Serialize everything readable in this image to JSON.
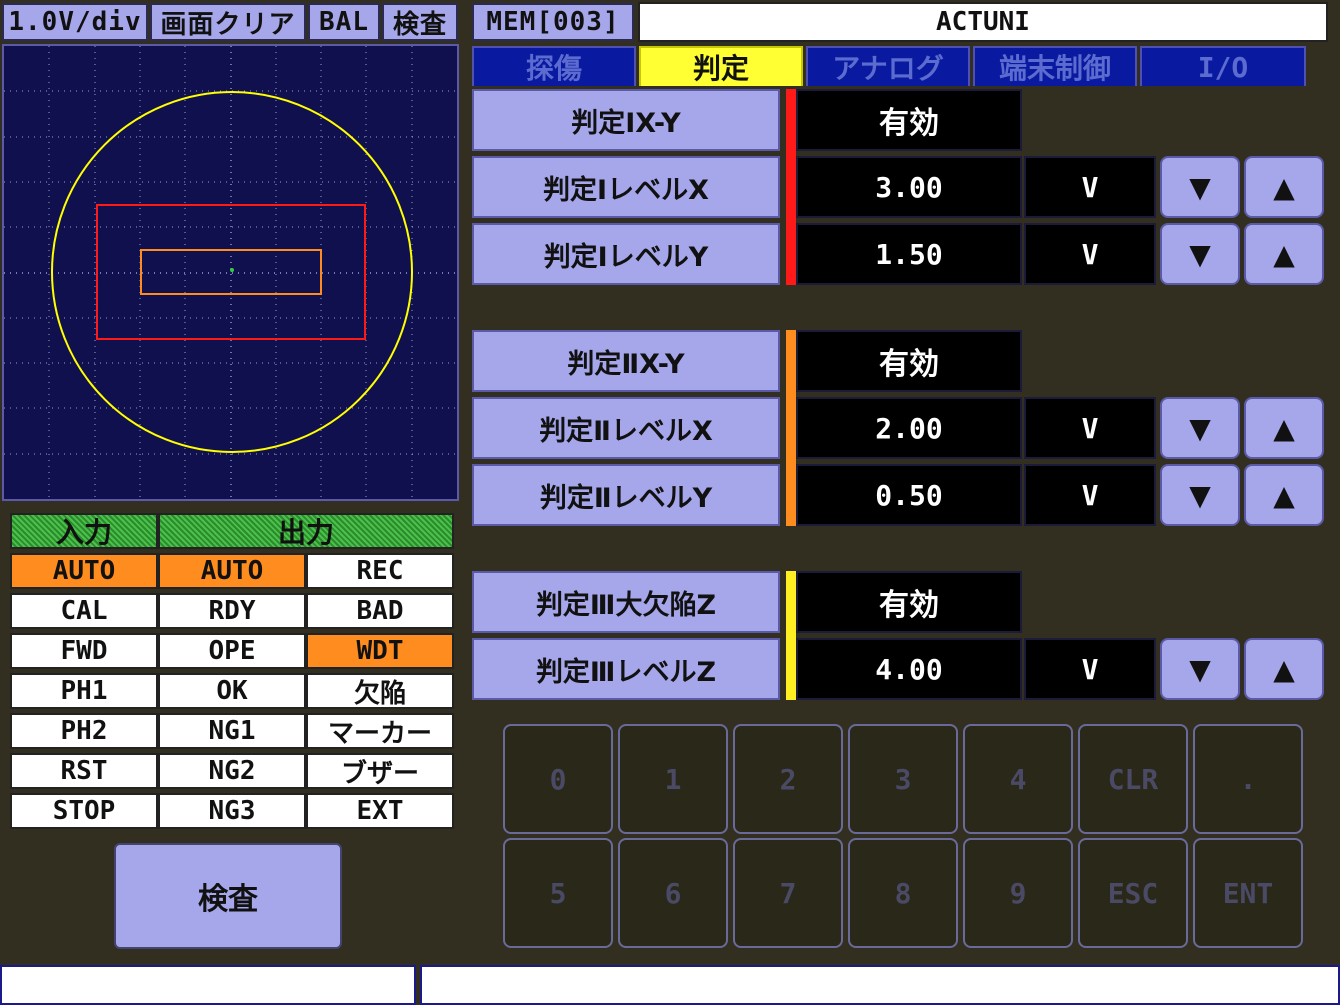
{
  "toolbar": {
    "scale": "1.0V/div",
    "clear": "画面クリア",
    "bal": "BAL",
    "inspect": "検査",
    "mem": "MEM[003]",
    "title": "ACTUNI"
  },
  "tabs": [
    "探傷",
    "判定",
    "アナログ",
    "端末制御",
    "I/O"
  ],
  "active_tab": "判定",
  "judge": {
    "j1": {
      "xy_label": "判定ⅠX-Y",
      "xy_value": "有効",
      "lx_label": "判定ⅠレベルX",
      "lx_value": "3.00",
      "lx_unit": "V",
      "ly_label": "判定ⅠレベルY",
      "ly_value": "1.50",
      "ly_unit": "V",
      "color": "#ff1a1a"
    },
    "j2": {
      "xy_label": "判定ⅡX-Y",
      "xy_value": "有効",
      "lx_label": "判定ⅡレベルX",
      "lx_value": "2.00",
      "lx_unit": "V",
      "ly_label": "判定ⅡレベルY",
      "ly_value": "0.50",
      "ly_unit": "V",
      "color": "#ff8c1e"
    },
    "j3": {
      "z_label": "判定Ⅲ大欠陥Z",
      "z_value": "有効",
      "lz_label": "判定ⅢレベルZ",
      "lz_value": "4.00",
      "lz_unit": "V",
      "color": "#ffee22"
    }
  },
  "arrows": {
    "down": "▼",
    "up": "▲"
  },
  "io": {
    "input_header": "入力",
    "output_header": "出力",
    "inputs": [
      "AUTO",
      "CAL",
      "FWD",
      "PH1",
      "PH2",
      "RST",
      "STOP"
    ],
    "outputs1": [
      "AUTO",
      "RDY",
      "OPE",
      "OK",
      "NG1",
      "NG2",
      "NG3"
    ],
    "outputs2": [
      "REC",
      "BAD",
      "WDT",
      "欠陥",
      "マーカー",
      "ブザー",
      "EXT"
    ]
  },
  "inspect_button": "検査",
  "keypad": {
    "row1": [
      "0",
      "1",
      "2",
      "3",
      "4",
      "CLR",
      "."
    ],
    "row2": [
      "5",
      "6",
      "7",
      "8",
      "9",
      "ESC",
      "ENT"
    ]
  },
  "colors": {
    "scope_bg": "#10104e",
    "circle": "#ffff00",
    "rect_outer": "#ff1a1a",
    "rect_inner": "#ff8c1e",
    "io_active": "#ff8c1e",
    "button": "#a6a6ea"
  }
}
